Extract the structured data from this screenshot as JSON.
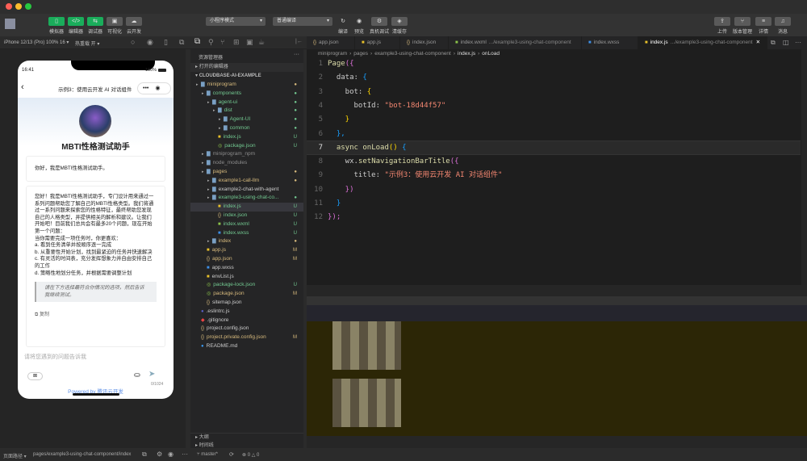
{
  "window": {
    "lights": [
      "#fe5f57",
      "#febc2e",
      "#28c840"
    ]
  },
  "toolbar": {
    "left_buttons": [
      {
        "label": "模拟器",
        "icon": "phone-icon",
        "glyph": "▯",
        "active": true
      },
      {
        "label": "编辑器",
        "icon": "code-icon",
        "glyph": "</>",
        "active": true
      },
      {
        "label": "调试器",
        "icon": "debug-icon",
        "glyph": "⇆",
        "active": true
      },
      {
        "label": "可视化",
        "icon": "visual-icon",
        "glyph": "▣",
        "active": false
      },
      {
        "label": "云开发",
        "icon": "cloud-icon",
        "glyph": "☁",
        "active": false
      }
    ],
    "mode_select": "小程序模式",
    "compile_select": "普通编译",
    "mid_buttons": [
      {
        "label": "编译",
        "glyph": "↻"
      },
      {
        "label": "预览",
        "glyph": "◉"
      },
      {
        "label": "真机调试",
        "glyph": "⚙"
      },
      {
        "label": "清缓存",
        "glyph": "◈"
      }
    ],
    "right_buttons": [
      {
        "label": "上传",
        "glyph": "⇪"
      },
      {
        "label": "版本管理",
        "glyph": "⑂"
      },
      {
        "label": "详情",
        "glyph": "≡"
      },
      {
        "label": "消息",
        "glyph": "♫"
      }
    ]
  },
  "simulator": {
    "device": "iPhone 12/13 (Pro) 100% 16 ▾",
    "hotreload": "热重载 开 ▾",
    "phone": {
      "time": "16:41",
      "battery": "100%",
      "nav_title": "示例3：使用云开发 AI 对话组件",
      "bot_name": "MBTI性格测试助手",
      "greeting": "你好，我是MBTI性格测试助手。",
      "message": "您好！我是MBTI性格测试助手，专门设计用来通过一系列问题帮助您了解自己的MBTI性格类型。我们将通过一系列问题来探索您的性格特征，最终帮助您发现自己的人格类型，并提供相关的解析和建议。让我们开始吧！目前我们总共会有最多20个问题，现在开始第一个问题：\n当你需要完成一项任务时，你更喜欢：\na. 看到任务清单并按顺序逐一完成\nb. 从重要性开始计划，找到最紧迫的任务并快速解决\nc. 有灵活的时间表，充分发挥想象力并自由安排自己的工作\nd. 策略性地划分任务，并根据需要调整计划",
      "quote": "请在下方选择最符合你情况的选项，然后告诉我继续测试。",
      "copy": "复制",
      "input_placeholder": "请将您遇到的问题告诉我",
      "counter": "0/1024",
      "powered_prefix": "Powered by ",
      "powered_brand": "腾讯云开发"
    }
  },
  "explorer": {
    "title": "资源管理器",
    "open_editors": "打开的编辑器",
    "project": "CLOUDBASE-AI-EXAMPLE",
    "items": [
      {
        "name": "miniprogram",
        "depth": 1,
        "type": "folder",
        "color": "#d7ba7d",
        "status": "●"
      },
      {
        "name": "components",
        "depth": 2,
        "type": "folder",
        "color": "#73c991",
        "status": "●"
      },
      {
        "name": "agent-ui",
        "depth": 3,
        "type": "folder",
        "color": "#73c991",
        "status": "●"
      },
      {
        "name": "dist",
        "depth": 4,
        "type": "folder",
        "color": "#73c991",
        "status": "●"
      },
      {
        "name": "Agent-UI",
        "depth": 5,
        "type": "folder",
        "color": "#73c991",
        "status": "●"
      },
      {
        "name": "common",
        "depth": 5,
        "type": "folder",
        "color": "#73c991",
        "status": "●"
      },
      {
        "name": "index.js",
        "depth": 4,
        "type": "js",
        "color": "#73c991",
        "status": "U"
      },
      {
        "name": "package.json",
        "depth": 4,
        "type": "npm",
        "color": "#73c991",
        "status": "U"
      },
      {
        "name": "miniprogram_npm",
        "depth": 2,
        "type": "folder",
        "color": "#8c8c8c",
        "status": ""
      },
      {
        "name": "node_modules",
        "depth": 2,
        "type": "folder",
        "color": "#8c8c8c",
        "status": ""
      },
      {
        "name": "pages",
        "depth": 2,
        "type": "folder",
        "color": "#d7ba7d",
        "status": "●"
      },
      {
        "name": "example1-call-llm",
        "depth": 3,
        "type": "folder",
        "color": "#d7ba7d",
        "status": "●"
      },
      {
        "name": "example2-chat-with-agent",
        "depth": 3,
        "type": "folder",
        "color": "#cccccc",
        "status": ""
      },
      {
        "name": "example3-using-chat-co...",
        "depth": 3,
        "type": "folder",
        "color": "#73c991",
        "status": "●"
      },
      {
        "name": "index.js",
        "depth": 4,
        "type": "js",
        "color": "#73c991",
        "status": "U",
        "selected": true
      },
      {
        "name": "index.json",
        "depth": 4,
        "type": "json",
        "color": "#73c991",
        "status": "U"
      },
      {
        "name": "index.wxml",
        "depth": 4,
        "type": "wxml",
        "color": "#73c991",
        "status": "U"
      },
      {
        "name": "index.wxss",
        "depth": 4,
        "type": "wxss",
        "color": "#73c991",
        "status": "U"
      },
      {
        "name": "index",
        "depth": 3,
        "type": "folder",
        "color": "#d7ba7d",
        "status": "●"
      },
      {
        "name": "app.js",
        "depth": 2,
        "type": "js",
        "color": "#d7ba7d",
        "status": "M"
      },
      {
        "name": "app.json",
        "depth": 2,
        "type": "json",
        "color": "#d7ba7d",
        "status": "M"
      },
      {
        "name": "app.wxss",
        "depth": 2,
        "type": "wxss",
        "color": "#cccccc",
        "status": ""
      },
      {
        "name": "envList.js",
        "depth": 2,
        "type": "js",
        "color": "#cccccc",
        "status": ""
      },
      {
        "name": "package-lock.json",
        "depth": 2,
        "type": "npm",
        "color": "#73c991",
        "status": "U"
      },
      {
        "name": "package.json",
        "depth": 2,
        "type": "npm",
        "color": "#d7ba7d",
        "status": "M"
      },
      {
        "name": "sitemap.json",
        "depth": 2,
        "type": "json",
        "color": "#cccccc",
        "status": ""
      },
      {
        "name": ".eslintrc.js",
        "depth": 1,
        "type": "eslint",
        "color": "#cccccc",
        "status": ""
      },
      {
        "name": ".gitignore",
        "depth": 1,
        "type": "git",
        "color": "#cccccc",
        "status": ""
      },
      {
        "name": "project.config.json",
        "depth": 1,
        "type": "json",
        "color": "#cccccc",
        "status": ""
      },
      {
        "name": "project.private.config.json",
        "depth": 1,
        "type": "json",
        "color": "#d7ba7d",
        "status": "M"
      },
      {
        "name": "README.md",
        "depth": 1,
        "type": "info",
        "color": "#cccccc",
        "status": ""
      }
    ],
    "outline": "大纲",
    "timeline": "时间线"
  },
  "editor": {
    "tabs": [
      {
        "name": "app.json",
        "icon": "{}"
      },
      {
        "name": "app.js",
        "icon": "js"
      },
      {
        "name": "index.json",
        "icon": "{}"
      },
      {
        "name": "index.wxml",
        "path": ".../example3-using-chat-component",
        "icon": "wx"
      },
      {
        "name": "index.wxss",
        "icon": "css"
      },
      {
        "name": "index.js",
        "path": ".../example3-using-chat-component",
        "icon": "js",
        "active": true
      }
    ],
    "breadcrumb": [
      "miniprogram",
      "pages",
      "example3-using-chat-component",
      "index.js",
      "onLoad"
    ],
    "lines": [
      [
        [
          "Page",
          "#dcdcaa"
        ],
        [
          "({",
          "#da70d6"
        ]
      ],
      [
        [
          "  data: ",
          "#cccccc"
        ],
        [
          "{",
          "#179fff"
        ]
      ],
      [
        [
          "    bot: ",
          "#cccccc"
        ],
        [
          "{",
          "#ffd700"
        ]
      ],
      [
        [
          "      botId: ",
          "#cccccc"
        ],
        [
          "\"bot-18d44f57\"",
          "#f48771"
        ]
      ],
      [
        [
          "    }",
          "#ffd700"
        ]
      ],
      [
        [
          "  },",
          "#179fff"
        ]
      ],
      [
        [
          "  async ",
          "#dcdcaa"
        ],
        [
          "onLoad",
          "#dcdcaa"
        ],
        [
          "() ",
          "#ffd700"
        ],
        [
          "{",
          "#179fff"
        ]
      ],
      [
        [
          "    wx.",
          "#cccccc"
        ],
        [
          "setNavigationBarTitle",
          "#dcdcaa"
        ],
        [
          "({",
          "#da70d6"
        ]
      ],
      [
        [
          "      title: ",
          "#cccccc"
        ],
        [
          "\"示例3：使用云开发 AI 对话组件\"",
          "#f48771"
        ]
      ],
      [
        [
          "    })",
          "#da70d6"
        ]
      ],
      [
        [
          "  }",
          "#179fff"
        ]
      ],
      [
        [
          "});",
          "#da70d6"
        ]
      ]
    ]
  },
  "statusbar": {
    "path_label": "页面路径 ▾",
    "path": "pages/example3-using-chat-component/index",
    "branch": "master*",
    "errors": "0",
    "warnings": "0"
  }
}
